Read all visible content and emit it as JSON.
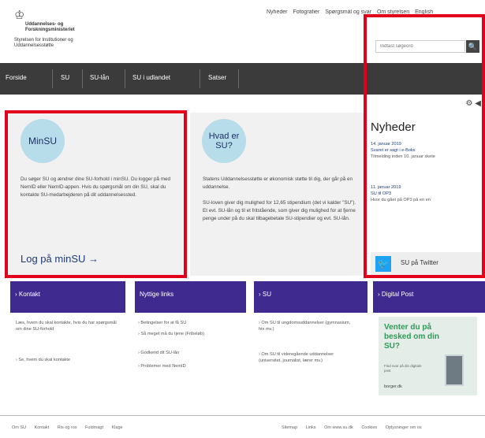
{
  "header": {
    "logo_ministry": "Uddannelses- og Forskningsministeriet",
    "logo_agency": "Styrelsen for Institutioner og Uddannelsesstøtte",
    "top_links": [
      "Nyheder",
      "Fotografier",
      "Spørgsmål og svar",
      "Om styrelsen",
      "English"
    ],
    "search_placeholder": "Indtast søgeord",
    "search_icon": "search-icon",
    "crown_icon": "crown-icon"
  },
  "nav": {
    "items": [
      "Forside",
      "SU",
      "SU-lån",
      "SU i udlandet",
      "Satser"
    ]
  },
  "minsu": {
    "circle_label": "MinSU",
    "text": "Du søger SU og ændrer dine SU-forhold i minSU. Du logger på med NemID eller NemID-appen. Hvis du spørgsmål om din SU, skal du kontakte SU-medarbejderen på dit uddannelsessted.",
    "link": "Log på minSU →"
  },
  "hvad": {
    "circle_label": "Hvad er SU?",
    "text1": "Statens Uddannelsesstøtte er økonomisk støtte til dig, der går på en uddannelse.",
    "text2": "SU-loven giver dig mulighed for 12,65 stipendium (det vi kalder \"SU\"). Et evt. SU-lån og til et fritstående, som giver dig mulighed for at fjerne penge under på du skal tilbagebetale SU-stipendier og evt. SU-lån."
  },
  "news": {
    "title": "Nyheder",
    "items": [
      {
        "date": "14. januar 2019",
        "link": "Svaret er sagt i e-Boks",
        "desc": "Tilmelding inden 10. januar skete"
      },
      {
        "date": "11. januar 2019",
        "link": "SU til OP3",
        "desc": "Hvor du gået på OP3 på en en"
      }
    ]
  },
  "twitter": {
    "label": "SU på Twitter"
  },
  "columns": [
    {
      "title": "› Kontakt",
      "links": [
        "Læs, hvem du skal kontakte, hvis du har spørgsmål om dine SU-forhold",
        "› Se, hvem du skal kontakte"
      ]
    },
    {
      "title": "Nyttige links",
      "links": [
        "› Betingelser for at få SU",
        "› Så meget må du tjene (Fribeløb)",
        "› Godkend dit SU-lån",
        "› Problemer med NemID"
      ]
    },
    {
      "title": "› SU",
      "links": [
        "› Om SU til ungdomsuddannelser (gymnasium, htx mv.)",
        "› Om SU til videregående uddannelser (universitet, journalist, lærer mv.)"
      ]
    },
    {
      "title": "› Digital Post",
      "links": []
    }
  ],
  "ad": {
    "title": "Venter du på besked om din SU?",
    "sub": "Find svar på din digitale post",
    "site": "borger.dk"
  },
  "footer": {
    "left": [
      "Om SU",
      "Kontakt",
      "Ris og ros",
      "Fuldmagt",
      "Klage"
    ],
    "right": [
      "Sitemap",
      "Links",
      "Om www.su.dk",
      "Cookies",
      "Oplysninger om os"
    ]
  },
  "colors": {
    "nav_bg": "#3b3b3b",
    "purple": "#3f2a8f",
    "highlight": "#e2001a",
    "circle": "#b7dcea",
    "link": "#1f3a7a",
    "twitter": "#1da1f2",
    "ad_green": "#2e9b58"
  }
}
